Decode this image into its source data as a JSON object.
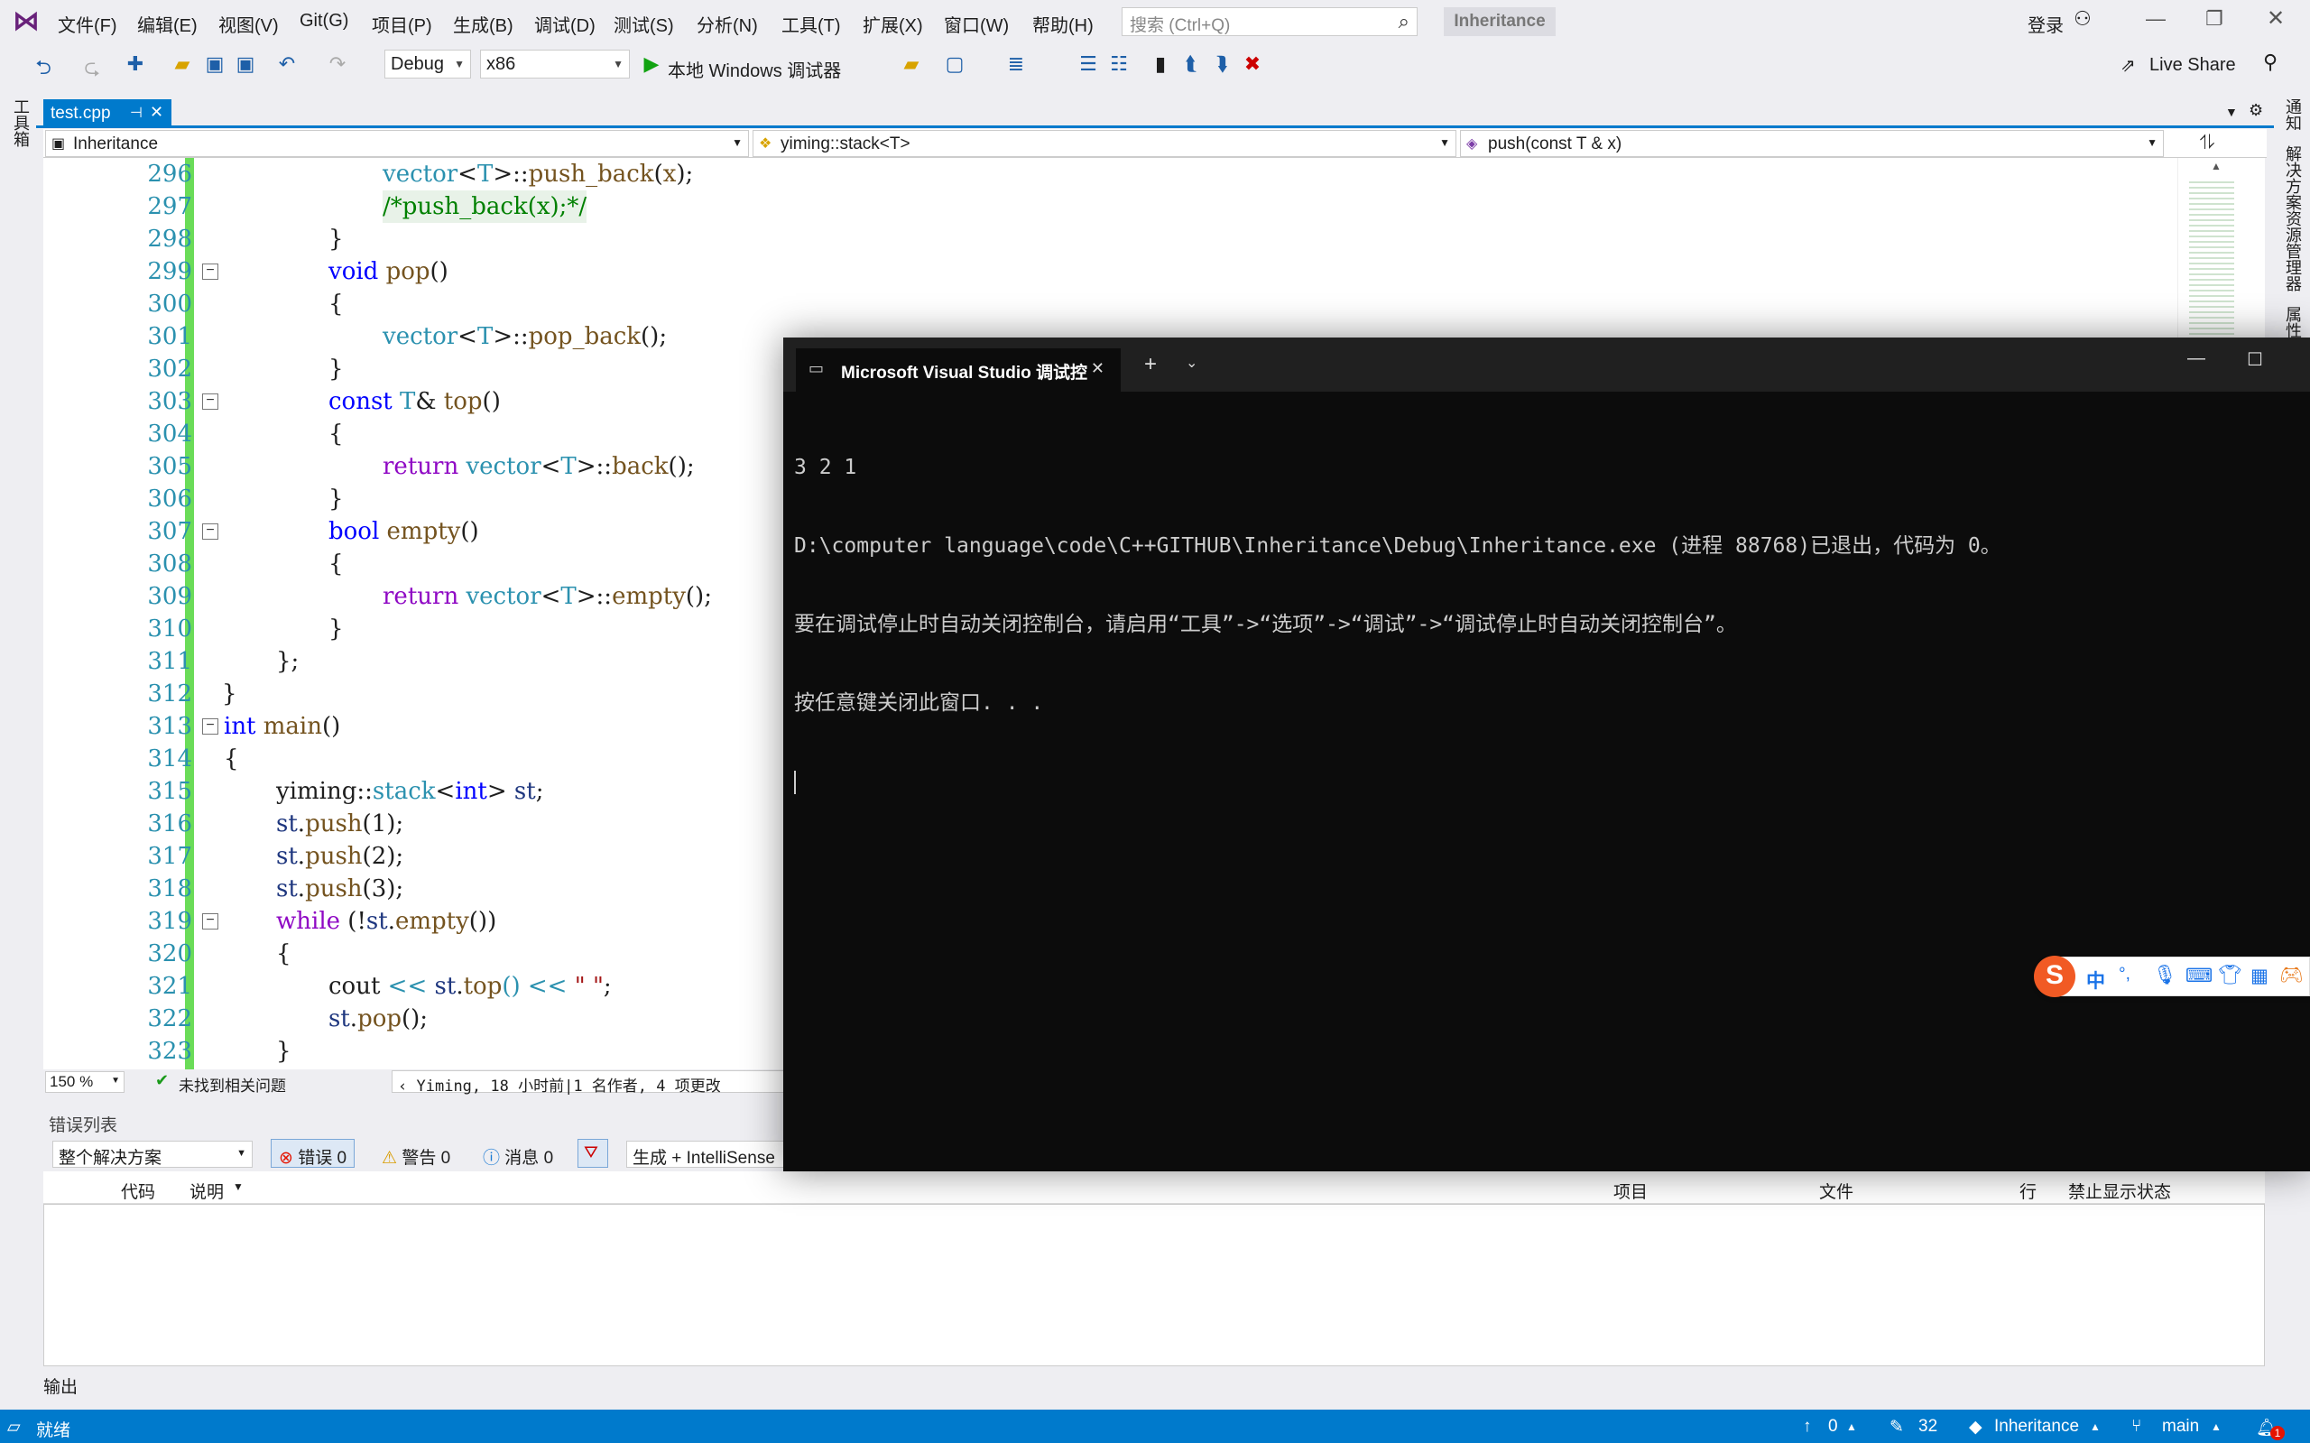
{
  "menu": [
    "文件(F)",
    "编辑(E)",
    "视图(V)",
    "Git(G)",
    "项目(P)",
    "生成(B)",
    "调试(D)",
    "测试(S)",
    "分析(N)",
    "工具(T)",
    "扩展(X)",
    "窗口(W)",
    "帮助(H)"
  ],
  "search": {
    "placeholder": "搜索 (Ctrl+Q)"
  },
  "solution_badge": "Inheritance",
  "account": {
    "login": "登录",
    "live_share": "Live Share"
  },
  "toolbar": {
    "config": "Debug",
    "platform": "x86",
    "run_label": "本地 Windows 调试器"
  },
  "left_strip": {
    "toolbox": "工具箱"
  },
  "right_strip": {
    "notifications": "通知",
    "solution_explorer": "解决方案资源管理器",
    "properties": "属性"
  },
  "tab": {
    "name": "test.cpp",
    "pin": "⊣",
    "close": "✕"
  },
  "nav": {
    "project": "Inheritance",
    "scope": "yiming::stack<T>",
    "member": "push(const T & x)"
  },
  "code_lines": [
    {
      "n": "296",
      "fold": ""
    },
    {
      "n": "297",
      "fold": ""
    },
    {
      "n": "298",
      "fold": ""
    },
    {
      "n": "299",
      "fold": "−"
    },
    {
      "n": "300",
      "fold": ""
    },
    {
      "n": "301",
      "fold": ""
    },
    {
      "n": "302",
      "fold": ""
    },
    {
      "n": "303",
      "fold": "−"
    },
    {
      "n": "304",
      "fold": ""
    },
    {
      "n": "305",
      "fold": ""
    },
    {
      "n": "306",
      "fold": ""
    },
    {
      "n": "307",
      "fold": "−"
    },
    {
      "n": "308",
      "fold": ""
    },
    {
      "n": "309",
      "fold": ""
    },
    {
      "n": "310",
      "fold": ""
    },
    {
      "n": "311",
      "fold": ""
    },
    {
      "n": "312",
      "fold": ""
    },
    {
      "n": "313",
      "fold": "−"
    },
    {
      "n": "314",
      "fold": ""
    },
    {
      "n": "315",
      "fold": ""
    },
    {
      "n": "316",
      "fold": ""
    },
    {
      "n": "317",
      "fold": ""
    },
    {
      "n": "318",
      "fold": ""
    },
    {
      "n": "319",
      "fold": "−"
    },
    {
      "n": "320",
      "fold": ""
    },
    {
      "n": "321",
      "fold": ""
    },
    {
      "n": "322",
      "fold": ""
    },
    {
      "n": "323",
      "fold": ""
    }
  ],
  "code_tokens": {
    "l296": [
      "vector",
      "<",
      "T",
      ">::",
      "push_back",
      "(",
      "x",
      ");"
    ],
    "l297": "/*push_back(x);*/",
    "l298": "}",
    "l299": [
      "void",
      " ",
      "pop",
      "()"
    ],
    "l300": "{",
    "l301": [
      "vector",
      "<",
      "T",
      ">::",
      "pop_back",
      "();"
    ],
    "l302": "}",
    "l303": [
      "const",
      " ",
      "T",
      "& ",
      "top",
      "()"
    ],
    "l304": "{",
    "l305": [
      "return",
      " ",
      "vector",
      "<",
      "T",
      ">::",
      "back",
      "();"
    ],
    "l306": "}",
    "l307": [
      "bool",
      " ",
      "empty",
      "()"
    ],
    "l308": "{",
    "l309": [
      "return",
      " ",
      "vector",
      "<",
      "T",
      ">::",
      "empty",
      "();"
    ],
    "l310": "}",
    "l311": "};",
    "l312": "}",
    "l313": [
      "int",
      " ",
      "main",
      "()"
    ],
    "l314": "{",
    "l315": [
      "yiming",
      "::",
      "stack",
      "<",
      "int",
      "> ",
      "st",
      ";"
    ],
    "l316": [
      "st",
      ".",
      "push",
      "(1);"
    ],
    "l317": [
      "st",
      ".",
      "push",
      "(2);"
    ],
    "l318": [
      "st",
      ".",
      "push",
      "(3);"
    ],
    "l319": [
      "while",
      " (!",
      "st",
      ".",
      "empty",
      "())"
    ],
    "l320": "{",
    "l321": [
      "cout",
      " << ",
      "st",
      ".",
      "top",
      "() << ",
      "\" \"",
      ";"
    ],
    "l322": [
      "st",
      ".",
      "pop",
      "();"
    ],
    "l323": "}"
  },
  "editor_status": {
    "zoom": "150 %",
    "issues": "未找到相关问题",
    "codelens": "Yiming, 18 小时前|1 名作者, 4 项更改"
  },
  "error_list": {
    "title": "错误列表",
    "scope": "整个解决方案",
    "errors": "错误 0",
    "warnings": "警告 0",
    "messages": "消息 0",
    "build_filter": "生成 + IntelliSense",
    "columns": {
      "code": "代码",
      "desc": "说明",
      "project": "项目",
      "file": "文件",
      "line": "行",
      "suppress": "禁止显示状态"
    }
  },
  "output_label": "输出",
  "statusbar": {
    "ready": "就绪",
    "up_count": "0",
    "edit_count": "32",
    "repo": "Inheritance",
    "branch": "main",
    "notify": "1"
  },
  "console": {
    "tab_title": "Microsoft Visual Studio 调试控",
    "lines": [
      "3 2 1",
      "D:\\computer language\\code\\C++GITHUB\\Inheritance\\Debug\\Inheritance.exe (进程 88768)已退出，代码为 0。",
      "要在调试停止时自动关闭控制台，请启用“工具”->“选项”->“调试”->“调试停止时自动关闭控制台”。",
      "按任意键关闭此窗口. . ."
    ]
  },
  "ime": {
    "lang": "中",
    "punct": "°,"
  }
}
